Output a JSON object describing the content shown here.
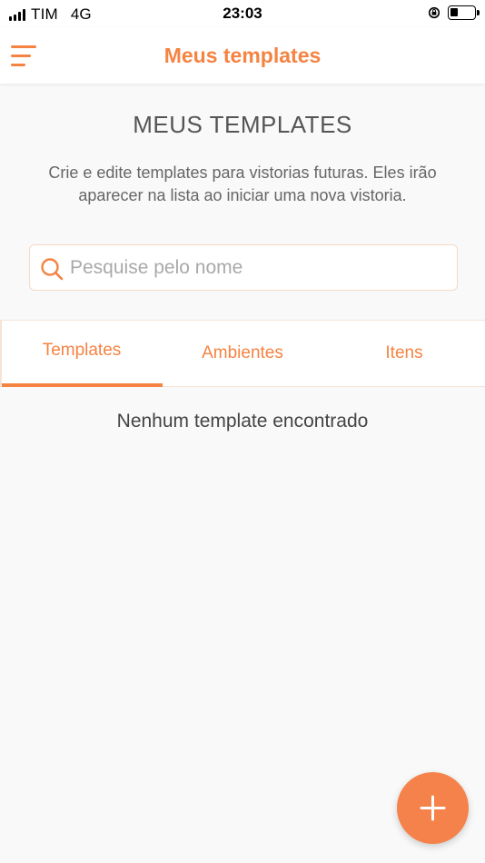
{
  "status_bar": {
    "carrier": "TIM",
    "network": "4G",
    "time": "23:03",
    "icons": [
      "signal-icon",
      "orientation-lock-icon",
      "battery-icon"
    ]
  },
  "header": {
    "title": "Meus templates",
    "menu_icon": "menu-icon"
  },
  "intro": {
    "title": "MEUS TEMPLATES",
    "description": "Crie e edite templates para vistorias futuras. Eles irão aparecer na lista ao iniciar uma nova vistoria."
  },
  "search": {
    "placeholder": "Pesquise pelo nome",
    "value": "",
    "icon": "search-icon"
  },
  "tabs": [
    {
      "label": "Templates",
      "active": true
    },
    {
      "label": "Ambientes",
      "active": false
    },
    {
      "label": "Itens",
      "active": false
    }
  ],
  "empty_message": "Nenhum template encontrado",
  "fab": {
    "icon": "plus-icon"
  },
  "colors": {
    "accent": "#f58342",
    "background": "#f9f9f9",
    "border": "#f6e3d6"
  }
}
